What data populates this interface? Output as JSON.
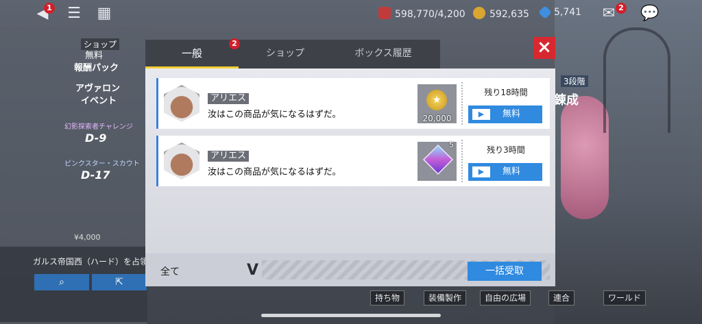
{
  "hud": {
    "power": "598,770/4,200",
    "gold": "592,635",
    "gems": "5,741",
    "left_badge": "1",
    "mail_badge": "2"
  },
  "side_menu": {
    "shop_label": "ショップ",
    "shop_free": "無料",
    "shop_pack": "報酬パック",
    "event_line1": "アヴァロン",
    "event_line2": "イベント",
    "stage1_title": "幻影探索者チャレンジ",
    "stage1": "D-9",
    "stage2_title": "ピンクスター・スカウト",
    "stage2": "D-17",
    "price": "¥4,000",
    "conquest_text": "ガルス帝国西（ハード）を占領",
    "search_icon": "magnifier-icon",
    "share_icon": "share-icon"
  },
  "dialog": {
    "tabs": [
      {
        "label": "一般",
        "badge": "2"
      },
      {
        "label": "ショップ"
      },
      {
        "label": "ボックス履歴"
      }
    ],
    "close": "×",
    "rows": [
      {
        "sender": "アリエス",
        "message": "汝はこの商品が気になるはずだ。",
        "reward_qty": "20,000",
        "time": "残り18時間",
        "free": "無料"
      },
      {
        "sender": "アリエス",
        "message": "汝はこの商品が気になるはずだ。",
        "reward_qty": "5",
        "time": "残り3時間",
        "free": "無料"
      }
    ],
    "footer_all": "全て",
    "collect_all": "一括受取"
  },
  "right_side": {
    "tier": "3段階",
    "refine": "錬成"
  },
  "bottom_bar": {
    "items": [
      "持ち物",
      "装備製作",
      "自由の広場",
      "連合",
      "ワールド"
    ]
  }
}
